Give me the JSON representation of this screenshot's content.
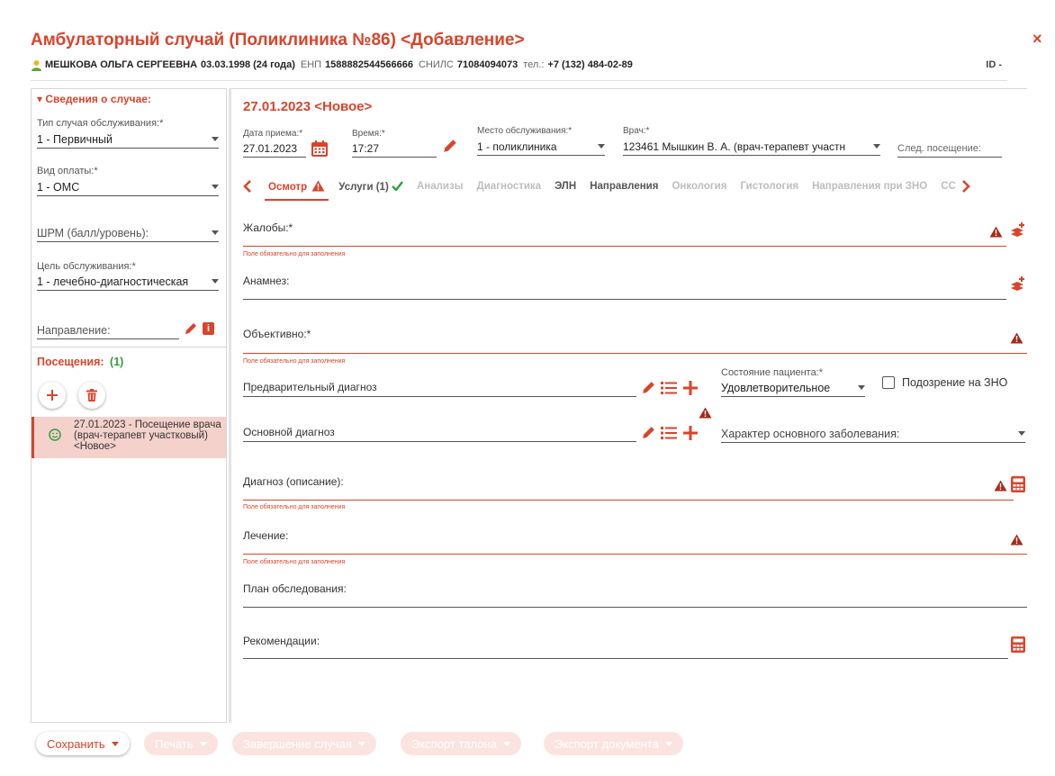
{
  "header": {
    "title": "Амбулаторный случай (Поликлиника №86) <Добавление>",
    "close_symbol": "×"
  },
  "patient": {
    "name": "МЕШКОВА ОЛЬГА СЕРГЕЕВНА",
    "dob": "03.03.1998 (24 года)",
    "enp_label": "ЕНП",
    "enp": "1588882544566666",
    "snils_label": "СНИЛС",
    "snils": "71084094073",
    "phone_label": "тел.:",
    "phone": "+7 (132) 484-02-89",
    "id": "ID -"
  },
  "case_info": {
    "title": "▾ Сведения о случае:",
    "service_type_label": "Тип случая обслуживания:*",
    "service_type_value": "1 - Первичный",
    "payment_label": "Вид оплаты:*",
    "payment_value": "1 - ОМС",
    "shrm_placeholder": "ШРМ (балл/уровень):",
    "goal_label": "Цель обслуживания:*",
    "goal_value": "1 - лечебно-диагностическая",
    "direction_label": "Направление:"
  },
  "visits": {
    "title": "Посещения:",
    "count": "(1)",
    "item": {
      "line1": "27.01.2023 - Посещение врача",
      "line2": "(врач-терапевт участковый)",
      "line3": "<Новое>"
    }
  },
  "visit_header": {
    "title": "27.01.2023 <Новое>",
    "date_label": "Дата приема:*",
    "date_value": "27.01.2023",
    "time_label": "Время:*",
    "time_value": "17:27",
    "place_label": "Место обслуживания:*",
    "place_value": "1 - поликлиника",
    "doctor_label": "Врач:*",
    "doctor_value": "123461 Мышкин В. А. (врач-терапевт участн",
    "next_visit_placeholder": "След. посещение:"
  },
  "tabs": [
    {
      "label": "Осмотр"
    },
    {
      "label": "Услуги (1)"
    },
    {
      "label": "Анализы"
    },
    {
      "label": "Диагностика"
    },
    {
      "label": "ЭЛН"
    },
    {
      "label": "Направления"
    },
    {
      "label": "Онкология"
    },
    {
      "label": "Гистология"
    },
    {
      "label": "Направления при ЗНО"
    },
    {
      "label": "СС"
    }
  ],
  "form": {
    "required_msg": "Поле обязательно для заполнения",
    "complaints": "Жалобы:*",
    "anamnesis": "Анамнез:",
    "objective": "Объективно:*",
    "prelim_diagnosis": "Предварительный диагноз",
    "patient_state_label": "Состояние пациента:*",
    "patient_state_value": "Удовлетворительное",
    "zno_suspicion": "Подозрение на ЗНО",
    "main_diagnosis": "Основной диагноз",
    "main_disease_nature": "Характер основного заболевания:",
    "diagnosis_desc": "Диагноз (описание):",
    "treatment": "Лечение:",
    "exam_plan": "План обследования:",
    "recommendations": "Рекомендации:"
  },
  "footer": {
    "save": "Сохранить",
    "print": "Печать",
    "finish": "Завершение случая",
    "export_ticket": "Экспорт талона",
    "export_doc": "Экспорт документа"
  },
  "colors": {
    "accent": "#d9442b",
    "success": "#2e9e3e",
    "visit_selected_bg": "#f5d1cc",
    "disabled_btn_bg": "#fbe3df"
  },
  "icons": [
    "close-icon",
    "person-icon",
    "calendar-icon",
    "pencil-icon",
    "info-icon",
    "plus-icon",
    "trash-icon",
    "smile-icon",
    "chevron-left-icon",
    "chevron-right-icon",
    "warning-icon",
    "check-icon",
    "template-icon",
    "list-icon",
    "calculator-icon"
  ]
}
